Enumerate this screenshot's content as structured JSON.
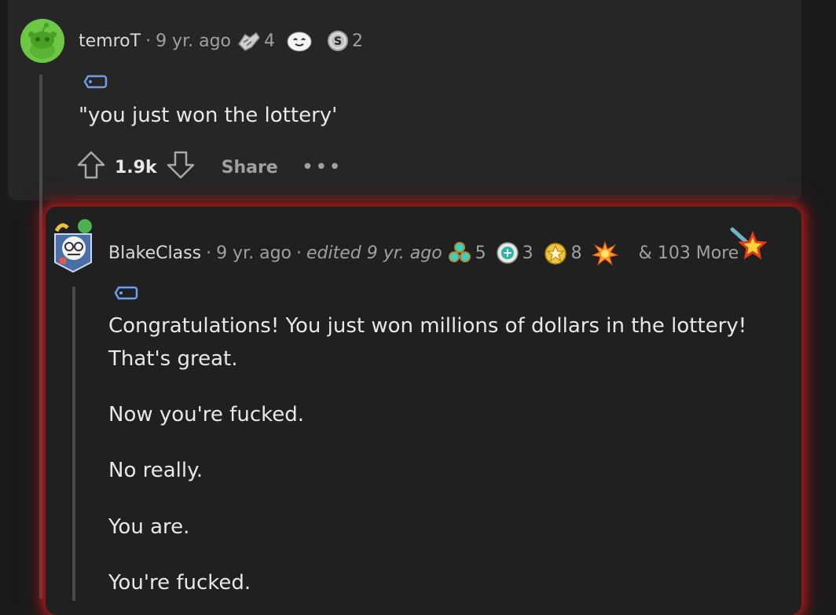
{
  "comment1": {
    "author": "temroT",
    "sep": "·",
    "time": "9 yr. ago",
    "awards": [
      {
        "icon": "handshake-award-icon",
        "count": "4"
      },
      {
        "icon": "wholesome-face-award-icon",
        "count": ""
      },
      {
        "icon": "silver-coin-award-icon",
        "count": "2"
      }
    ],
    "body": "\"you just won the lottery'",
    "score": "1.9k",
    "share_label": "Share",
    "more_label": "•••"
  },
  "comment2": {
    "author": "BlakeClass",
    "sep": "·",
    "time": "9 yr. ago",
    "edited": "edited 9 yr. ago",
    "awards": [
      {
        "icon": "triple-orb-award-icon",
        "count": "5"
      },
      {
        "icon": "target-award-icon",
        "count": "3"
      },
      {
        "icon": "gold-star-award-icon",
        "count": "8"
      },
      {
        "icon": "explosion-award-icon",
        "count": ""
      }
    ],
    "more_awards": "& 103 More",
    "paragraphs": [
      "Congratulations! You just won millions of dollars in the lottery!",
      "That's great.",
      "Now you're fucked.",
      "No really.",
      "You are.",
      "You're fucked."
    ]
  },
  "colors": {
    "background": "#1a1a1b",
    "card": "#262627",
    "glow": "#d21e19",
    "avatar_green": "#6cc744"
  }
}
